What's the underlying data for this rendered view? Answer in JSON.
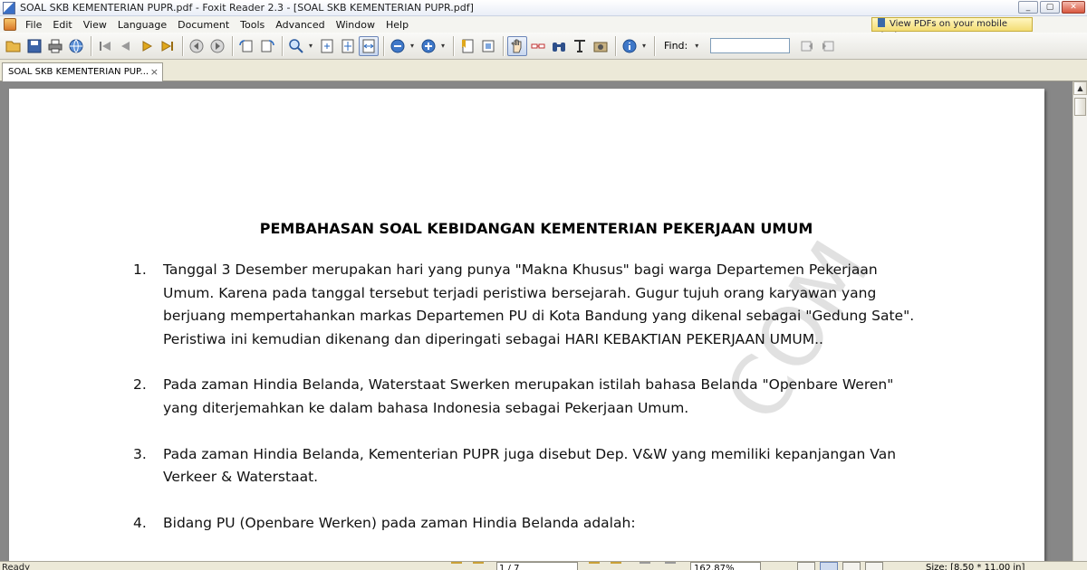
{
  "window": {
    "title": "SOAL SKB KEMENTERIAN PUPR.pdf - Foxit Reader 2.3 - [SOAL SKB KEMENTERIAN PUPR.pdf]",
    "controls": {
      "minimize": "_",
      "maximize": "▢",
      "close": "✕"
    }
  },
  "menu": {
    "items": [
      "File",
      "Edit",
      "View",
      "Language",
      "Document",
      "Tools",
      "Advanced",
      "Window",
      "Help"
    ],
    "promo": "View PDFs on your mobile devices"
  },
  "toolbar": {
    "find_label": "Find:",
    "find_value": "",
    "dropdown_glyph": "▾"
  },
  "tab": {
    "label": "SOAL SKB KEMENTERIAN PUP...",
    "close": "×"
  },
  "document": {
    "title": "PEMBAHASAN SOAL KEBIDANGAN KEMENTERIAN PEKERJAAN UMUM",
    "items": [
      {
        "num": "1.",
        "text": "Tanggal 3 Desember merupakan hari yang punya \"Makna Khusus\" bagi warga Departemen Pekerjaan Umum. Karena pada tanggal tersebut  terjadi peristiwa bersejarah. Gugur tujuh orang karyawan yang berjuang mempertahankan markas Departemen PU di Kota Bandung yang dikenal sebagai \"Gedung Sate\". Peristiwa ini kemudian dikenang dan diperingati sebagai HARI KEBAKTIAN PEKERJAAN UMUM.."
      },
      {
        "num": "2.",
        "text": "Pada zaman Hindia Belanda, Waterstaat Swerken merupakan istilah bahasa Belanda \"Openbare Weren\" yang diterjemahkan ke dalam bahasa Indonesia sebagai Pekerjaan Umum."
      },
      {
        "num": "3.",
        "text": "Pada zaman Hindia Belanda, Kementerian PUPR juga disebut Dep. V&W yang memiliki kepanjangan Van Verkeer & Waterstaat."
      },
      {
        "num": "4.",
        "text": "Bidang PU (Openbare Werken) pada zaman Hindia Belanda adalah:"
      }
    ],
    "watermark": "COM"
  },
  "status": {
    "ready": "Ready",
    "page": "1 / 7",
    "zoom": "162.87%",
    "size": "Size: [8.50 * 11.00 in]"
  },
  "colors": {
    "viewer_bg": "#878787",
    "chrome": "#ece9d8",
    "promo": "#f3dc73"
  }
}
